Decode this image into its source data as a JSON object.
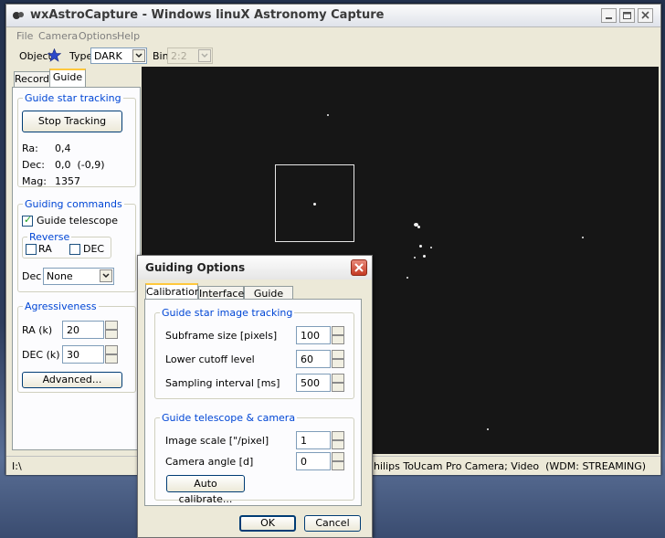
{
  "window": {
    "title": "wxAstroCapture - Windows linuX Astronomy Capture",
    "menu": [
      "File",
      "Camera",
      "Options",
      "Help"
    ]
  },
  "toolbar": {
    "object_label": "Object",
    "type_label": "Type",
    "type_value": "DARK",
    "bin_label": "Bin",
    "bin_value": "2:2"
  },
  "left_tabs": [
    "Record",
    "Guide"
  ],
  "guide_star_tracking": {
    "title": "Guide star tracking",
    "button": "Stop Tracking",
    "ra_label": "Ra:",
    "ra_value": "0,4",
    "dec_label": "Dec:",
    "dec_value": "0,0  (-0,9)",
    "mag_label": "Mag:",
    "mag_value": "1357"
  },
  "guiding_commands": {
    "title": "Guiding commands",
    "guide_telescope": "Guide telescope",
    "reverse_title": "Reverse",
    "ra": "RA",
    "dec": "DEC",
    "dec_label": "Dec",
    "dec_select": "None"
  },
  "aggressiveness": {
    "title": "Agressiveness",
    "ra_label": "RA (k)",
    "ra_value": "20",
    "dec_label": "DEC (k)",
    "dec_value": "30",
    "advanced_button": "Advanced..."
  },
  "status": {
    "left": "I:\\",
    "right": "hilips ToUcam Pro Camera; Video  (WDM: STREAMING)"
  },
  "dialog": {
    "title": "Guiding Options",
    "tabs": [
      "Calibration",
      "Interface",
      "Guide Port"
    ],
    "group1_title": "Guide star image tracking",
    "subframe_label": "Subframe size [pixels]",
    "subframe_value": "100",
    "cutoff_label": "Lower cutoff level",
    "cutoff_value": "60",
    "sampling_label": "Sampling interval [ms]",
    "sampling_value": "500",
    "group2_title": "Guide telescope & camera",
    "scale_label": "Image scale [\"/pixel]",
    "scale_value": "1",
    "angle_label": "Camera angle [d]",
    "angle_value": "0",
    "autocal_button": "Auto calibrate...",
    "ok": "OK",
    "cancel": "Cancel"
  },
  "colors": {
    "group_title": "#0046d5",
    "sky": "#161616",
    "tab_highlight": "#ffc83c"
  }
}
